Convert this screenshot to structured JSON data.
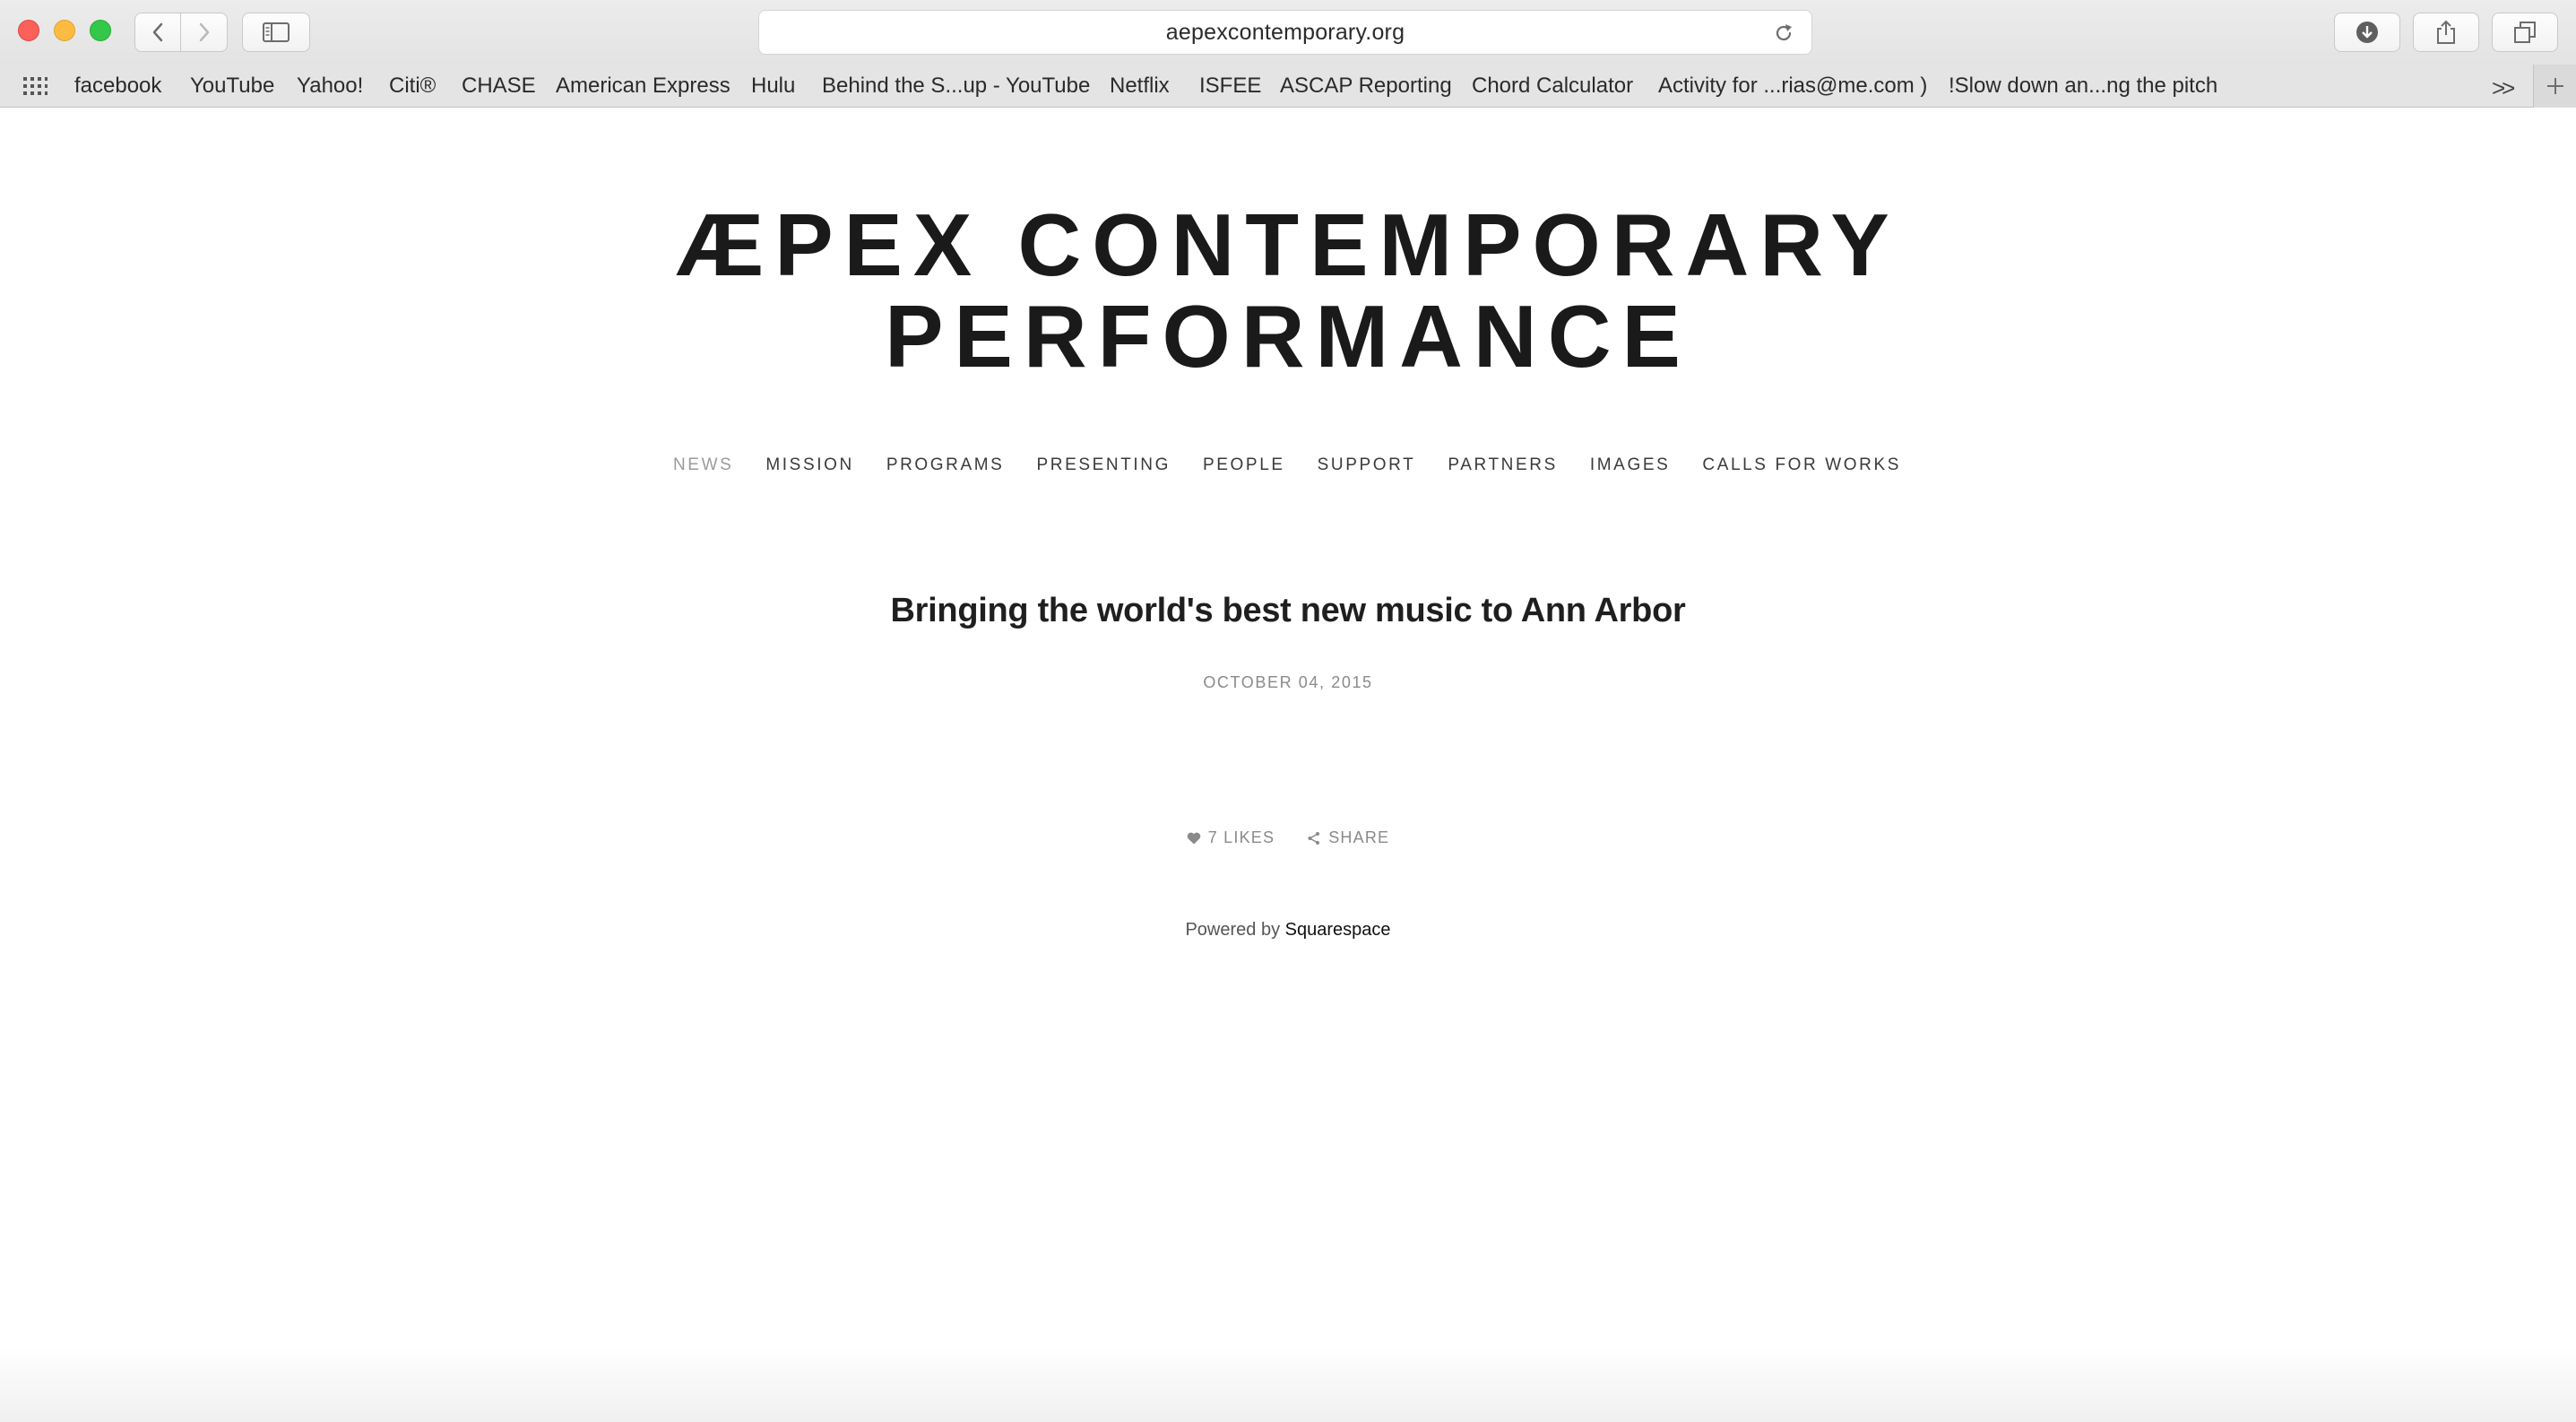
{
  "browser": {
    "url": "aepexcontemporary.org",
    "bookmarks": [
      "facebook",
      "YouTube",
      "Yahoo!",
      "Citi®",
      "CHASE",
      "American Express",
      "Hulu",
      "Behind the S...up - YouTube",
      "Netflix",
      "ISFEE",
      "ASCAP Reporting",
      "Chord Calculator",
      "Activity for ...rias@me.com )",
      "!Slow down an...ng the pitch"
    ],
    "icons": {
      "back": "chevron-left-icon",
      "forward": "chevron-right-icon",
      "sidebar": "sidebar-icon",
      "reload": "reload-icon",
      "downloads": "download-icon",
      "share": "share-icon",
      "tabs": "tabs-icon",
      "apps": "grid-icon",
      "more": "double-chevron-icon",
      "new_tab": "plus-icon"
    }
  },
  "site": {
    "title_line1": "ÆPEX CONTEMPORARY",
    "title_line2": "PERFORMANCE",
    "nav": [
      "NEWS",
      "MISSION",
      "PROGRAMS",
      "PRESENTING",
      "PEOPLE",
      "SUPPORT",
      "PARTNERS",
      "IMAGES",
      "CALLS FOR WORKS"
    ],
    "active_nav": "NEWS"
  },
  "post": {
    "title": "Bringing the world's best new music to Ann Arbor",
    "date": "OCTOBER 04, 2015",
    "likes": "7 LIKES",
    "share": "SHARE"
  },
  "footer": {
    "powered_by": "Powered by",
    "platform": "Squarespace"
  },
  "colors": {
    "close": "#fc605b",
    "minimize": "#fdbc40",
    "zoom": "#34c84a",
    "title_text": "#1a1a1a",
    "muted_text": "#8a8a8a"
  }
}
